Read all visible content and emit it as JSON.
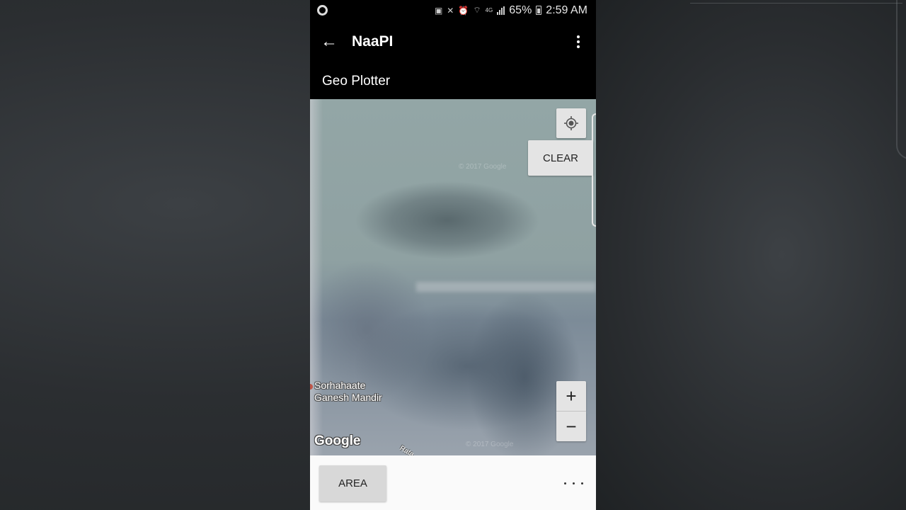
{
  "status_bar": {
    "battery_percent": "65%",
    "time": "2:59 AM",
    "icons": [
      "record-indicator-icon",
      "cast-icon",
      "mute-vibrate-icon",
      "alarm-icon",
      "wifi-icon",
      "lte-icon",
      "signal-icon",
      "battery-charging-icon"
    ],
    "lte_label": "4G"
  },
  "app_bar": {
    "title": "NaaPI",
    "back_icon": "arrow-left-icon",
    "menu_icon": "more-vert-icon"
  },
  "subtitle": "Geo Plotter",
  "map": {
    "my_location_icon": "my-location-icon",
    "clear_label": "CLEAR",
    "zoom_in_label": "+",
    "zoom_out_label": "−",
    "place_label_line1": "Sorhahaate",
    "place_label_line2": "Ganesh Mandir",
    "logo": "Google",
    "copyright_top": "© 2017 Google",
    "copyright_bottom": "© 2017 Google",
    "road_label": "Rata"
  },
  "bottom_bar": {
    "area_label": "AREA",
    "more_label": "..."
  }
}
